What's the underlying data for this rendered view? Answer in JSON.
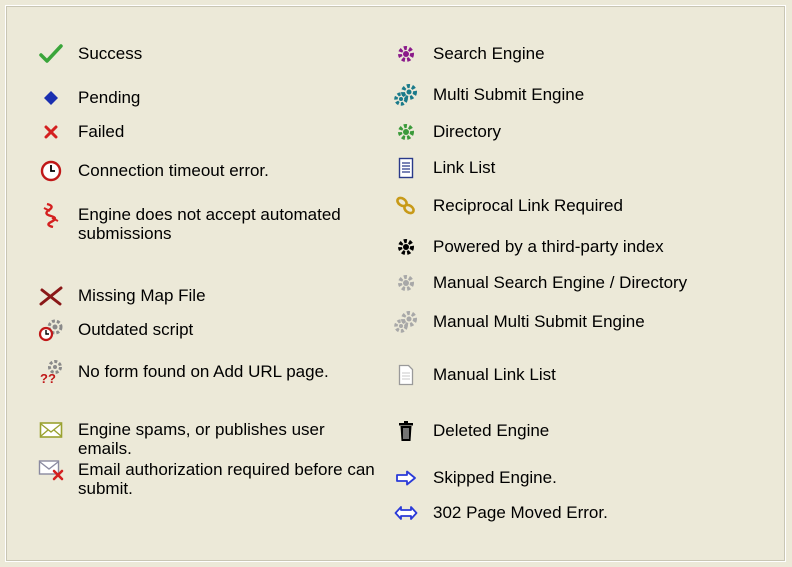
{
  "legend": {
    "left": [
      {
        "icon": "checkmark-icon",
        "label": "Success"
      },
      {
        "icon": "blue-diamond-icon",
        "label": "Pending"
      },
      {
        "icon": "red-x-icon",
        "label": "Failed"
      },
      {
        "icon": "clock-icon",
        "label": "Connection timeout error."
      },
      {
        "icon": "broken-chain-icon",
        "label": "Engine does not accept automated submissions"
      },
      {
        "icon": "crossed-sticks-icon",
        "label": "Missing Map File"
      },
      {
        "icon": "clock-gear-icon",
        "label": "Outdated script"
      },
      {
        "icon": "gear-question-icon",
        "label": "No form found on Add URL page."
      },
      {
        "icon": "envelope-icon",
        "label": "Engine spams, or publishes user emails."
      },
      {
        "icon": "envelope-x-icon",
        "label": "Email authorization required before can submit."
      }
    ],
    "right": [
      {
        "icon": "purple-gear-icon",
        "label": "Search Engine"
      },
      {
        "icon": "teal-gears-icon",
        "label": "Multi Submit Engine"
      },
      {
        "icon": "green-gear-icon",
        "label": "Directory"
      },
      {
        "icon": "document-list-icon",
        "label": "Link List"
      },
      {
        "icon": "chain-link-icon",
        "label": "Reciprocal Link Required"
      },
      {
        "icon": "black-gear-icon",
        "label": "Powered by a third-party index"
      },
      {
        "icon": "gray-gear-icon",
        "label": "Manual Search Engine / Directory"
      },
      {
        "icon": "gray-gears-icon",
        "label": "Manual Multi Submit Engine"
      },
      {
        "icon": "blank-document-icon",
        "label": "Manual Link List"
      },
      {
        "icon": "trash-can-icon",
        "label": "Deleted Engine"
      },
      {
        "icon": "right-arrow-icon",
        "label": "Skipped Engine."
      },
      {
        "icon": "double-arrow-icon",
        "label": "302 Page Moved Error."
      }
    ]
  },
  "colors": {
    "background": "#ece9d8",
    "success": "#3aa53a",
    "pending": "#1a2fb0",
    "failed": "#d42020",
    "search_engine": "#8a1a8a",
    "multi_submit": "#1a7a8a",
    "directory": "#3a9a3a",
    "manual": "#a8a8a8",
    "arrow": "#2a3ad8"
  }
}
